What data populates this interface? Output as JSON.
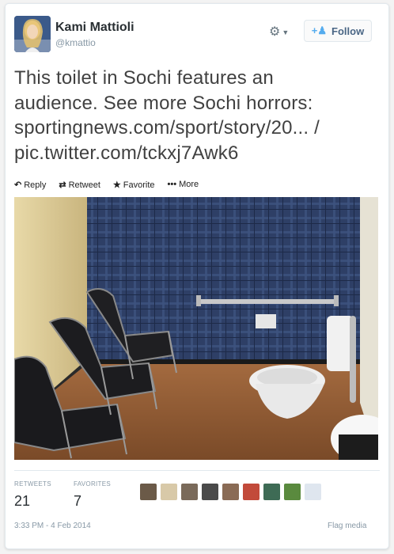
{
  "author": {
    "name": "Kami Mattioli",
    "handle": "@kmattio"
  },
  "header": {
    "gear_icon": "gear-icon",
    "follow_label": "Follow"
  },
  "tweet": {
    "lines": [
      "This toilet in Sochi features an",
      "audience. See more Sochi horrors:",
      "sportingnews.com/sport/story/20... /",
      "pic.twitter.com/tckxj7Awk6"
    ]
  },
  "actions": {
    "reply": "Reply",
    "retweet": "Retweet",
    "favorite": "Favorite",
    "more": "More"
  },
  "stats": {
    "retweets_label": "RETWEETS",
    "retweets_value": "21",
    "favorites_label": "FAVORITES",
    "favorites_value": "7"
  },
  "footer": {
    "timestamp": "3:33 PM - 4 Feb 2014",
    "flag": "Flag media"
  },
  "colors": {
    "link_blue": "#55acee",
    "text_gray": "#8899a6",
    "wall_plaid": "#2e3f66"
  }
}
